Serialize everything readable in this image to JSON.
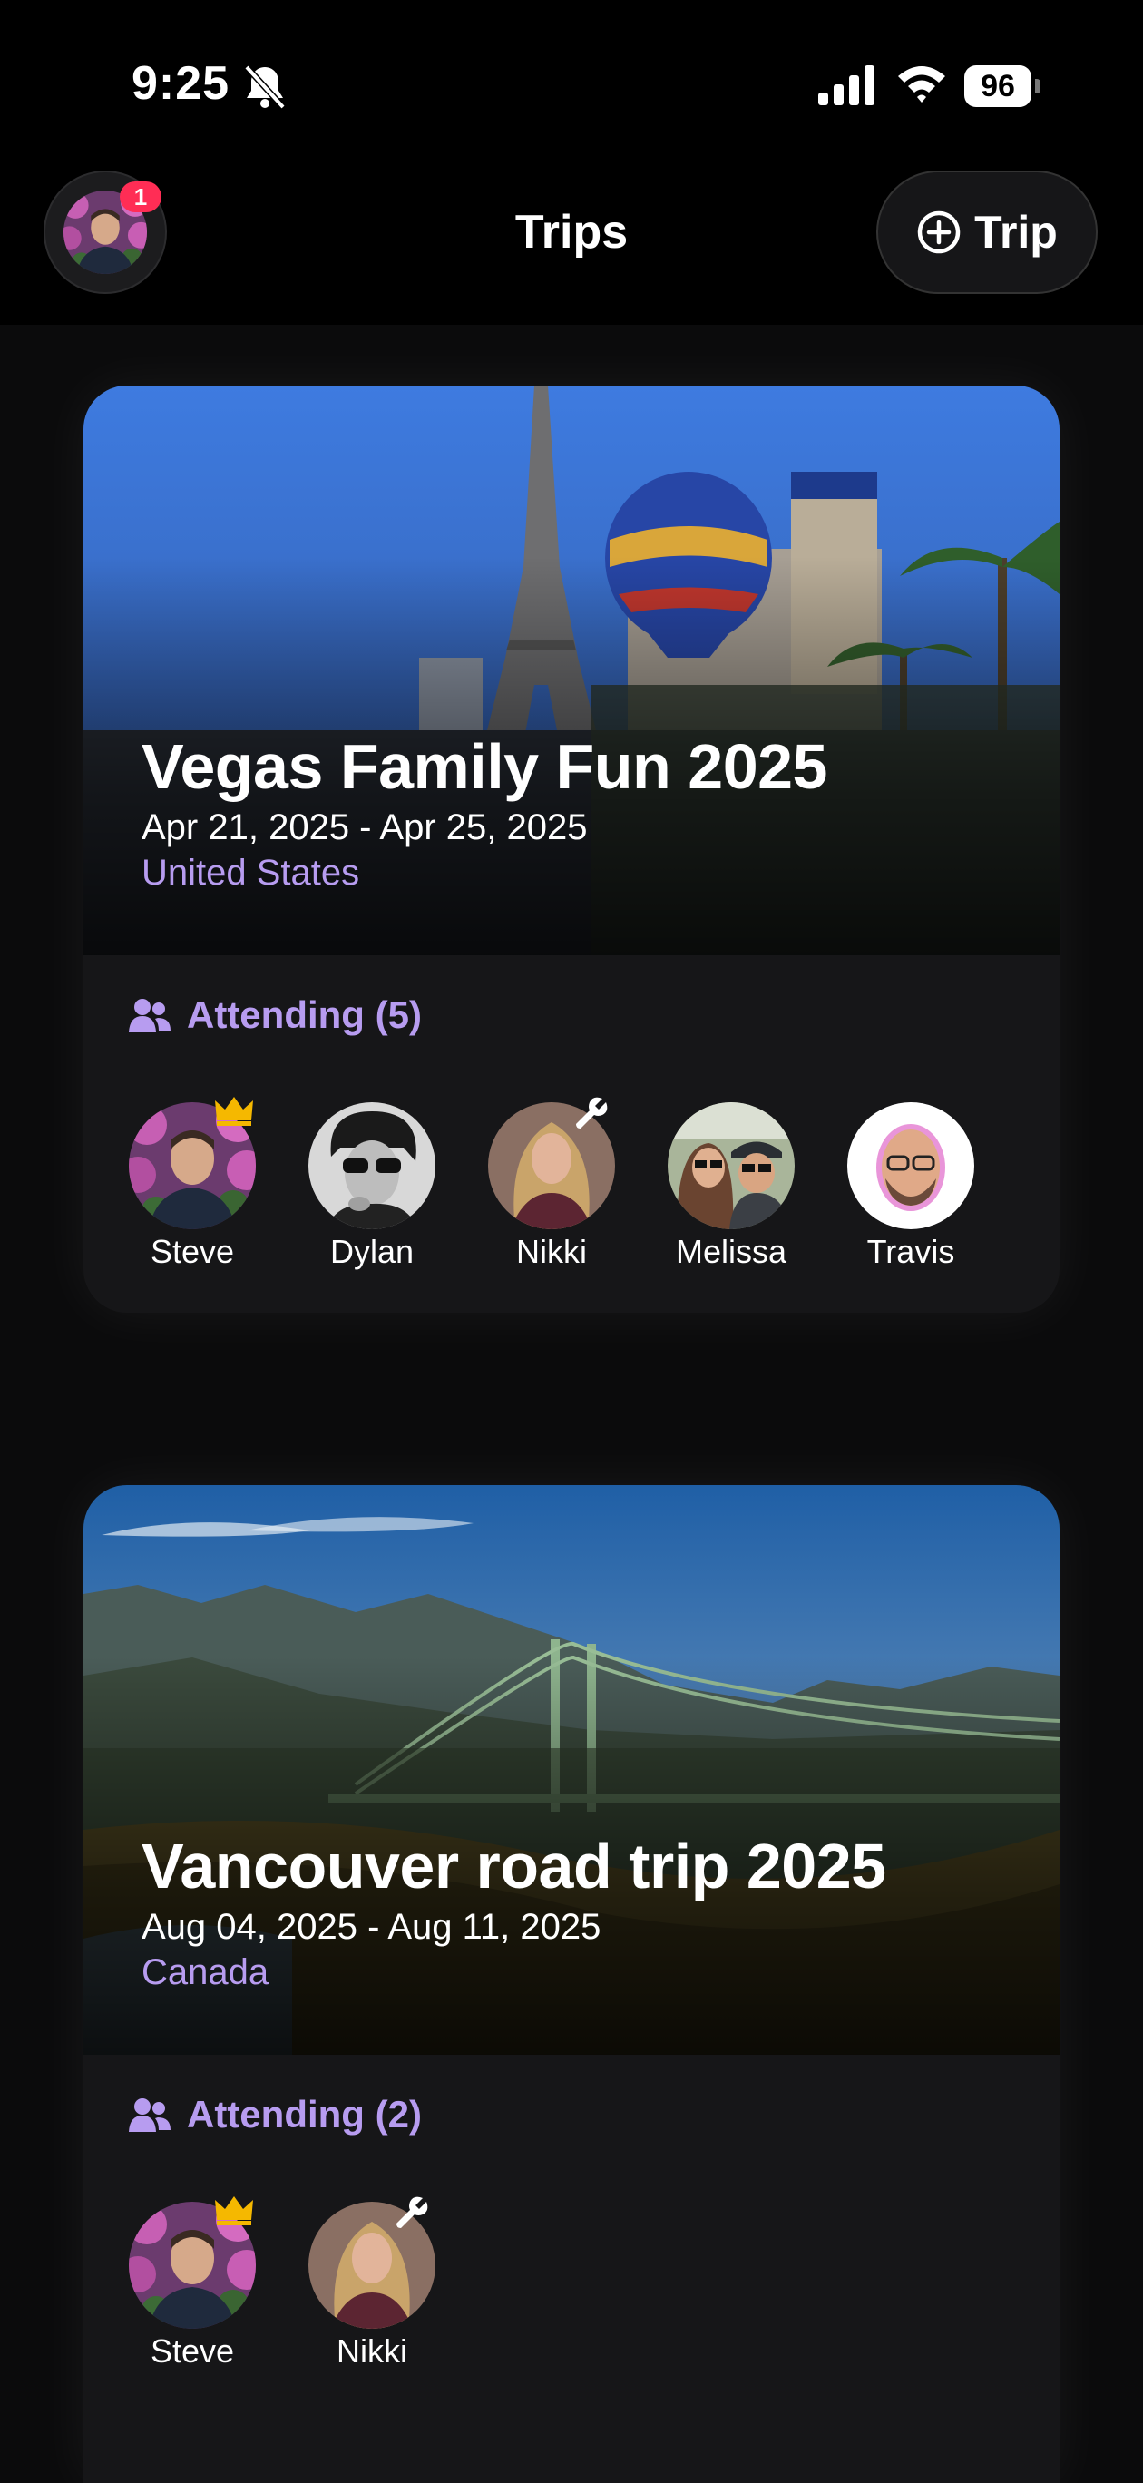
{
  "status_bar": {
    "time": "9:25",
    "battery": "96"
  },
  "nav": {
    "title": "Trips",
    "notification_count": "1",
    "add_trip_label": "Trip"
  },
  "trips": [
    {
      "title": "Vegas Family Fun 2025",
      "dates": "Apr 21, 2025 - Apr 25, 2025",
      "country": "United States",
      "attending_label": "Attending (5)",
      "attendees": [
        {
          "name": "Steve",
          "role": "owner"
        },
        {
          "name": "Dylan",
          "role": ""
        },
        {
          "name": "Nikki",
          "role": "editor"
        },
        {
          "name": "Melissa",
          "role": ""
        },
        {
          "name": "Travis",
          "role": ""
        }
      ]
    },
    {
      "title": "Vancouver road trip 2025",
      "dates": "Aug 04, 2025 - Aug 11, 2025",
      "country": "Canada",
      "attending_label": "Attending (2)",
      "attendees": [
        {
          "name": "Steve",
          "role": "owner"
        },
        {
          "name": "Nikki",
          "role": "editor"
        }
      ]
    }
  ],
  "colors": {
    "accent": "#b79cf0",
    "badge": "#ff2d55",
    "crown": "#f5b800"
  },
  "icons": [
    "bell-slash-icon",
    "signal-icon",
    "wifi-icon",
    "battery-icon",
    "plus-circle-icon",
    "people-icon",
    "crown-icon",
    "wrench-icon"
  ]
}
